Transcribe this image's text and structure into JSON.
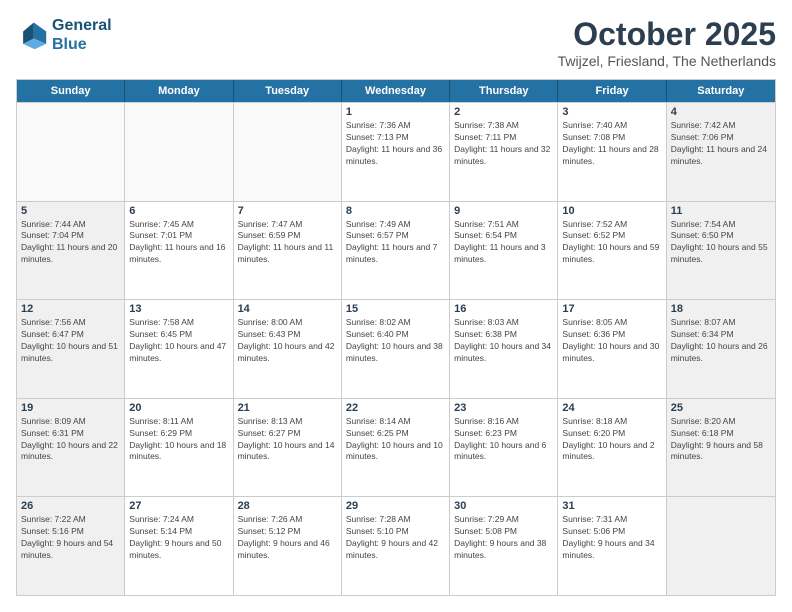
{
  "header": {
    "logo_line1": "General",
    "logo_line2": "Blue",
    "month": "October 2025",
    "location": "Twijzel, Friesland, The Netherlands"
  },
  "days_of_week": [
    "Sunday",
    "Monday",
    "Tuesday",
    "Wednesday",
    "Thursday",
    "Friday",
    "Saturday"
  ],
  "weeks": [
    [
      {
        "day": "",
        "info": "",
        "empty": true
      },
      {
        "day": "",
        "info": "",
        "empty": true
      },
      {
        "day": "",
        "info": "",
        "empty": true
      },
      {
        "day": "1",
        "info": "Sunrise: 7:36 AM\nSunset: 7:13 PM\nDaylight: 11 hours and 36 minutes.",
        "empty": false
      },
      {
        "day": "2",
        "info": "Sunrise: 7:38 AM\nSunset: 7:11 PM\nDaylight: 11 hours and 32 minutes.",
        "empty": false
      },
      {
        "day": "3",
        "info": "Sunrise: 7:40 AM\nSunset: 7:08 PM\nDaylight: 11 hours and 28 minutes.",
        "empty": false
      },
      {
        "day": "4",
        "info": "Sunrise: 7:42 AM\nSunset: 7:06 PM\nDaylight: 11 hours and 24 minutes.",
        "empty": false,
        "shaded": true
      }
    ],
    [
      {
        "day": "5",
        "info": "Sunrise: 7:44 AM\nSunset: 7:04 PM\nDaylight: 11 hours and 20 minutes.",
        "empty": false,
        "shaded": true
      },
      {
        "day": "6",
        "info": "Sunrise: 7:45 AM\nSunset: 7:01 PM\nDaylight: 11 hours and 16 minutes.",
        "empty": false
      },
      {
        "day": "7",
        "info": "Sunrise: 7:47 AM\nSunset: 6:59 PM\nDaylight: 11 hours and 11 minutes.",
        "empty": false
      },
      {
        "day": "8",
        "info": "Sunrise: 7:49 AM\nSunset: 6:57 PM\nDaylight: 11 hours and 7 minutes.",
        "empty": false
      },
      {
        "day": "9",
        "info": "Sunrise: 7:51 AM\nSunset: 6:54 PM\nDaylight: 11 hours and 3 minutes.",
        "empty": false
      },
      {
        "day": "10",
        "info": "Sunrise: 7:52 AM\nSunset: 6:52 PM\nDaylight: 10 hours and 59 minutes.",
        "empty": false
      },
      {
        "day": "11",
        "info": "Sunrise: 7:54 AM\nSunset: 6:50 PM\nDaylight: 10 hours and 55 minutes.",
        "empty": false,
        "shaded": true
      }
    ],
    [
      {
        "day": "12",
        "info": "Sunrise: 7:56 AM\nSunset: 6:47 PM\nDaylight: 10 hours and 51 minutes.",
        "empty": false,
        "shaded": true
      },
      {
        "day": "13",
        "info": "Sunrise: 7:58 AM\nSunset: 6:45 PM\nDaylight: 10 hours and 47 minutes.",
        "empty": false
      },
      {
        "day": "14",
        "info": "Sunrise: 8:00 AM\nSunset: 6:43 PM\nDaylight: 10 hours and 42 minutes.",
        "empty": false
      },
      {
        "day": "15",
        "info": "Sunrise: 8:02 AM\nSunset: 6:40 PM\nDaylight: 10 hours and 38 minutes.",
        "empty": false
      },
      {
        "day": "16",
        "info": "Sunrise: 8:03 AM\nSunset: 6:38 PM\nDaylight: 10 hours and 34 minutes.",
        "empty": false
      },
      {
        "day": "17",
        "info": "Sunrise: 8:05 AM\nSunset: 6:36 PM\nDaylight: 10 hours and 30 minutes.",
        "empty": false
      },
      {
        "day": "18",
        "info": "Sunrise: 8:07 AM\nSunset: 6:34 PM\nDaylight: 10 hours and 26 minutes.",
        "empty": false,
        "shaded": true
      }
    ],
    [
      {
        "day": "19",
        "info": "Sunrise: 8:09 AM\nSunset: 6:31 PM\nDaylight: 10 hours and 22 minutes.",
        "empty": false,
        "shaded": true
      },
      {
        "day": "20",
        "info": "Sunrise: 8:11 AM\nSunset: 6:29 PM\nDaylight: 10 hours and 18 minutes.",
        "empty": false
      },
      {
        "day": "21",
        "info": "Sunrise: 8:13 AM\nSunset: 6:27 PM\nDaylight: 10 hours and 14 minutes.",
        "empty": false
      },
      {
        "day": "22",
        "info": "Sunrise: 8:14 AM\nSunset: 6:25 PM\nDaylight: 10 hours and 10 minutes.",
        "empty": false
      },
      {
        "day": "23",
        "info": "Sunrise: 8:16 AM\nSunset: 6:23 PM\nDaylight: 10 hours and 6 minutes.",
        "empty": false
      },
      {
        "day": "24",
        "info": "Sunrise: 8:18 AM\nSunset: 6:20 PM\nDaylight: 10 hours and 2 minutes.",
        "empty": false
      },
      {
        "day": "25",
        "info": "Sunrise: 8:20 AM\nSunset: 6:18 PM\nDaylight: 9 hours and 58 minutes.",
        "empty": false,
        "shaded": true
      }
    ],
    [
      {
        "day": "26",
        "info": "Sunrise: 7:22 AM\nSunset: 5:16 PM\nDaylight: 9 hours and 54 minutes.",
        "empty": false,
        "shaded": true
      },
      {
        "day": "27",
        "info": "Sunrise: 7:24 AM\nSunset: 5:14 PM\nDaylight: 9 hours and 50 minutes.",
        "empty": false
      },
      {
        "day": "28",
        "info": "Sunrise: 7:26 AM\nSunset: 5:12 PM\nDaylight: 9 hours and 46 minutes.",
        "empty": false
      },
      {
        "day": "29",
        "info": "Sunrise: 7:28 AM\nSunset: 5:10 PM\nDaylight: 9 hours and 42 minutes.",
        "empty": false
      },
      {
        "day": "30",
        "info": "Sunrise: 7:29 AM\nSunset: 5:08 PM\nDaylight: 9 hours and 38 minutes.",
        "empty": false
      },
      {
        "day": "31",
        "info": "Sunrise: 7:31 AM\nSunset: 5:06 PM\nDaylight: 9 hours and 34 minutes.",
        "empty": false
      },
      {
        "day": "",
        "info": "",
        "empty": true,
        "shaded": true
      }
    ]
  ]
}
